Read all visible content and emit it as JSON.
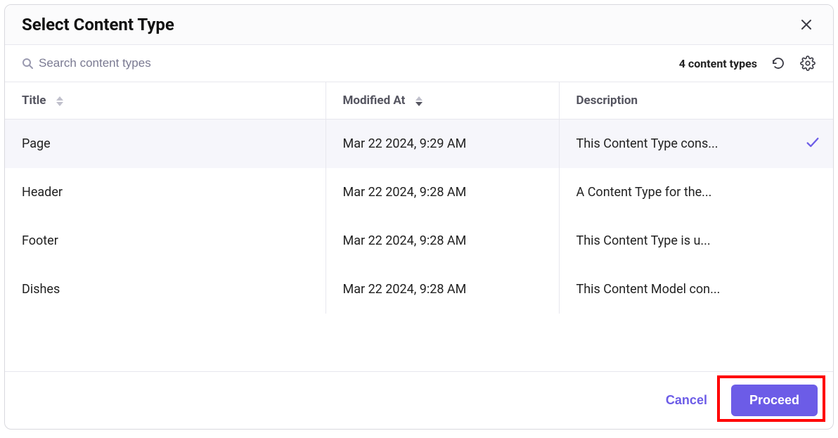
{
  "modal": {
    "title": "Select Content Type"
  },
  "search": {
    "placeholder": "Search content types"
  },
  "toolbar": {
    "count_text": "4 content types"
  },
  "columns": {
    "title": "Title",
    "modified": "Modified At",
    "description": "Description"
  },
  "rows": [
    {
      "title": "Page",
      "modified": "Mar 22 2024, 9:29 AM",
      "description": "This Content Type cons...",
      "selected": true
    },
    {
      "title": "Header",
      "modified": "Mar 22 2024, 9:28 AM",
      "description": "A Content Type for the...",
      "selected": false
    },
    {
      "title": "Footer",
      "modified": "Mar 22 2024, 9:28 AM",
      "description": "This Content Type is u...",
      "selected": false
    },
    {
      "title": "Dishes",
      "modified": "Mar 22 2024, 9:28 AM",
      "description": "This Content Model con...",
      "selected": false
    }
  ],
  "footer": {
    "cancel": "Cancel",
    "proceed": "Proceed"
  }
}
